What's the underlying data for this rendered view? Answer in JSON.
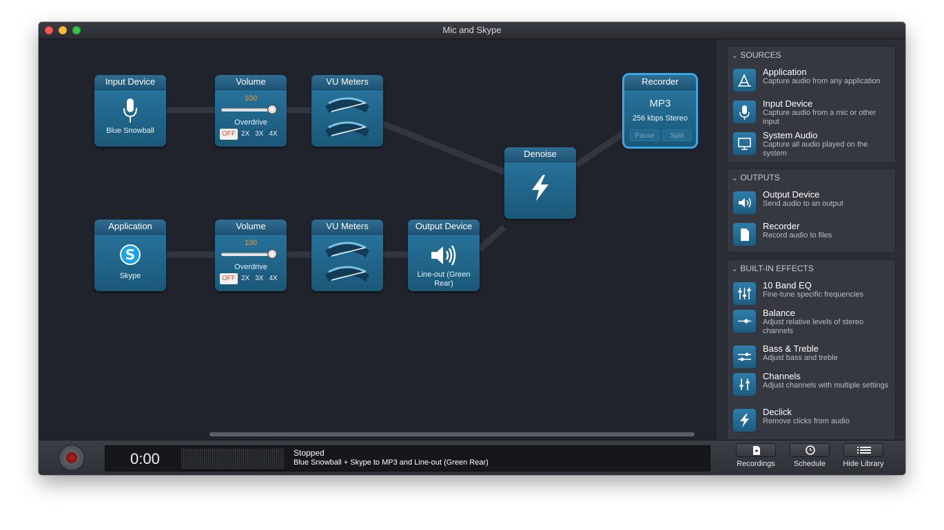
{
  "window": {
    "title": "Mic and Skype"
  },
  "nodes": {
    "input_device": {
      "title": "Input Device",
      "subtitle": "Blue Snowball",
      "icon": "microphone-icon"
    },
    "volume_top": {
      "title": "Volume",
      "value": "100",
      "overdrive_label": "Overdrive",
      "options": [
        "OFF",
        "2X",
        "3X",
        "4X"
      ],
      "selected": "OFF"
    },
    "vu_top": {
      "title": "VU Meters"
    },
    "recorder": {
      "title": "Recorder",
      "format": "MP3",
      "rate": "256 kbps Stereo",
      "pause_label": "Pause",
      "split_label": "Split"
    },
    "denoise": {
      "title": "Denoise",
      "icon": "lightning-icon"
    },
    "application": {
      "title": "Application",
      "subtitle": "Skype",
      "icon": "skype-icon"
    },
    "volume_bottom": {
      "title": "Volume",
      "value": "100",
      "overdrive_label": "Overdrive",
      "options": [
        "OFF",
        "2X",
        "3X",
        "4X"
      ],
      "selected": "OFF"
    },
    "vu_bottom": {
      "title": "VU Meters"
    },
    "output_device": {
      "title": "Output Device",
      "subtitle": "Line-out (Green Rear)",
      "icon": "speaker-icon"
    }
  },
  "library": {
    "sources": {
      "title": "SOURCES",
      "items": [
        {
          "title": "Application",
          "desc": "Capture audio from any application",
          "icon": "app-store-icon"
        },
        {
          "title": "Input Device",
          "desc": "Capture audio from a mic or other input",
          "icon": "microphone-icon"
        },
        {
          "title": "System Audio",
          "desc": "Capture all audio played on the system",
          "icon": "monitor-icon"
        }
      ]
    },
    "outputs": {
      "title": "OUTPUTS",
      "items": [
        {
          "title": "Output Device",
          "desc": "Send audio to an output",
          "icon": "speaker-icon"
        },
        {
          "title": "Recorder",
          "desc": "Record audio to files",
          "icon": "document-icon"
        }
      ]
    },
    "effects": {
      "title": "BUILT-IN EFFECTS",
      "items": [
        {
          "title": "10 Band EQ",
          "desc": "Fine-tune specific frequencies",
          "icon": "eq-icon"
        },
        {
          "title": "Balance",
          "desc": "Adjust relative levels of stereo channels",
          "icon": "balance-icon"
        },
        {
          "title": "Bass & Treble",
          "desc": "Adjust bass and treble",
          "icon": "bass-treble-icon"
        },
        {
          "title": "Channels",
          "desc": "Adjust channels with multiple settings",
          "icon": "channels-icon"
        },
        {
          "title": "Declick",
          "desc": "Remove clicks from audio",
          "icon": "declick-icon"
        }
      ]
    }
  },
  "status": {
    "time": "0:00",
    "state": "Stopped",
    "description": "Blue Snowball + Skype to MP3 and Line-out (Green Rear)"
  },
  "toolbar": {
    "recordings": "Recordings",
    "schedule": "Schedule",
    "hide_library": "Hide Library"
  },
  "colors": {
    "accent": "#3ba8e6",
    "node": "#2a78a3",
    "overdrive_value": "#f39a30",
    "record": "#b32020"
  }
}
